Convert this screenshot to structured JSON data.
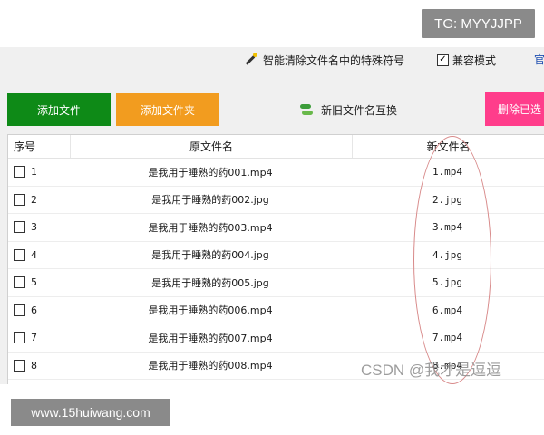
{
  "watermarks": {
    "top": "TG: MYYJJPP",
    "bottom": "www.15huiwang.com",
    "csdn": "CSDN @我才是逗逗"
  },
  "toolbar": {
    "clean_special_chars": "智能清除文件名中的特殊符号",
    "compat_mode_label": "兼容模式",
    "compat_mode_checked": true,
    "official_link_partial": "官",
    "add_file": "添加文件",
    "add_folder": "添加文件夹",
    "swap_names": "新旧文件名互换",
    "delete_selected_partial": "删除已选"
  },
  "colors": {
    "add_file": "#0e8a17",
    "add_folder": "#f29c1f",
    "delete": "#ff3d8b",
    "annotation_circle": "#d88a8a"
  },
  "table": {
    "headers": {
      "seq": "序号",
      "original": "原文件名",
      "new": "新文件名"
    },
    "rows": [
      {
        "seq": "1",
        "original": "是我用于睡熟的药001.mp4",
        "new": "1.mp4"
      },
      {
        "seq": "2",
        "original": "是我用于睡熟的药002.jpg",
        "new": "2.jpg"
      },
      {
        "seq": "3",
        "original": "是我用于睡熟的药003.mp4",
        "new": "3.mp4"
      },
      {
        "seq": "4",
        "original": "是我用于睡熟的药004.jpg",
        "new": "4.jpg"
      },
      {
        "seq": "5",
        "original": "是我用于睡熟的药005.jpg",
        "new": "5.jpg"
      },
      {
        "seq": "6",
        "original": "是我用于睡熟的药006.mp4",
        "new": "6.mp4"
      },
      {
        "seq": "7",
        "original": "是我用于睡熟的药007.mp4",
        "new": "7.mp4"
      },
      {
        "seq": "8",
        "original": "是我用于睡熟的药008.mp4",
        "new": "8.mp4"
      }
    ]
  }
}
